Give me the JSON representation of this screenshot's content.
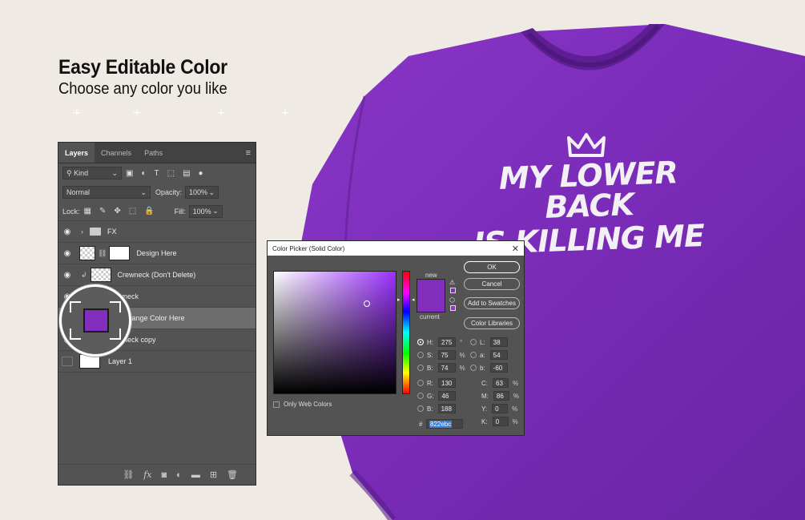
{
  "heading": {
    "title": "Easy Editable Color",
    "subtitle": "Choose any color you like"
  },
  "shirt": {
    "color": "#7a2bb8",
    "line1": "MY LOWER BACK",
    "line2": "IS KILLING ME"
  },
  "layers_panel": {
    "tabs": [
      "Layers",
      "Channels",
      "Paths"
    ],
    "kind_label": "Kind",
    "blend_mode": "Normal",
    "opacity_label": "Opacity:",
    "opacity_value": "100%",
    "lock_label": "Lock:",
    "fill_label": "Fill:",
    "fill_value": "100%",
    "layers": [
      {
        "name": "FX"
      },
      {
        "name": "Design Here"
      },
      {
        "name": "Crewneck (Don't Delete)"
      },
      {
        "name": "Crewneck"
      },
      {
        "name": "Change Color Here"
      },
      {
        "name": "Crewneck copy"
      },
      {
        "name": "Layer 1"
      }
    ]
  },
  "color_picker": {
    "title": "Color Picker (Solid Color)",
    "new_label": "new",
    "current_label": "current",
    "buttons": {
      "ok": "OK",
      "cancel": "Cancel",
      "add_swatches": "Add to Swatches",
      "libraries": "Color Libraries"
    },
    "only_web_colors": "Only Web Colors",
    "hsb": {
      "h": "275",
      "s": "75",
      "b": "74"
    },
    "lab": {
      "l": "38",
      "a": "54",
      "b": "-60"
    },
    "rgb": {
      "r": "130",
      "g": "46",
      "b": "188"
    },
    "cmyk": {
      "c": "63",
      "m": "86",
      "y": "0",
      "k": "0"
    },
    "hex": "822ebc",
    "labels": {
      "h": "H:",
      "s": "S:",
      "b": "B:",
      "r": "R:",
      "g": "G:",
      "bb": "B:",
      "l": "L:",
      "a": "a:",
      "lb": "b:",
      "c": "C:",
      "m": "M:",
      "y": "Y:",
      "k": "K:",
      "hash": "#"
    },
    "units": {
      "deg": "°",
      "pct": "%"
    },
    "selected_color": "#822ebc"
  }
}
